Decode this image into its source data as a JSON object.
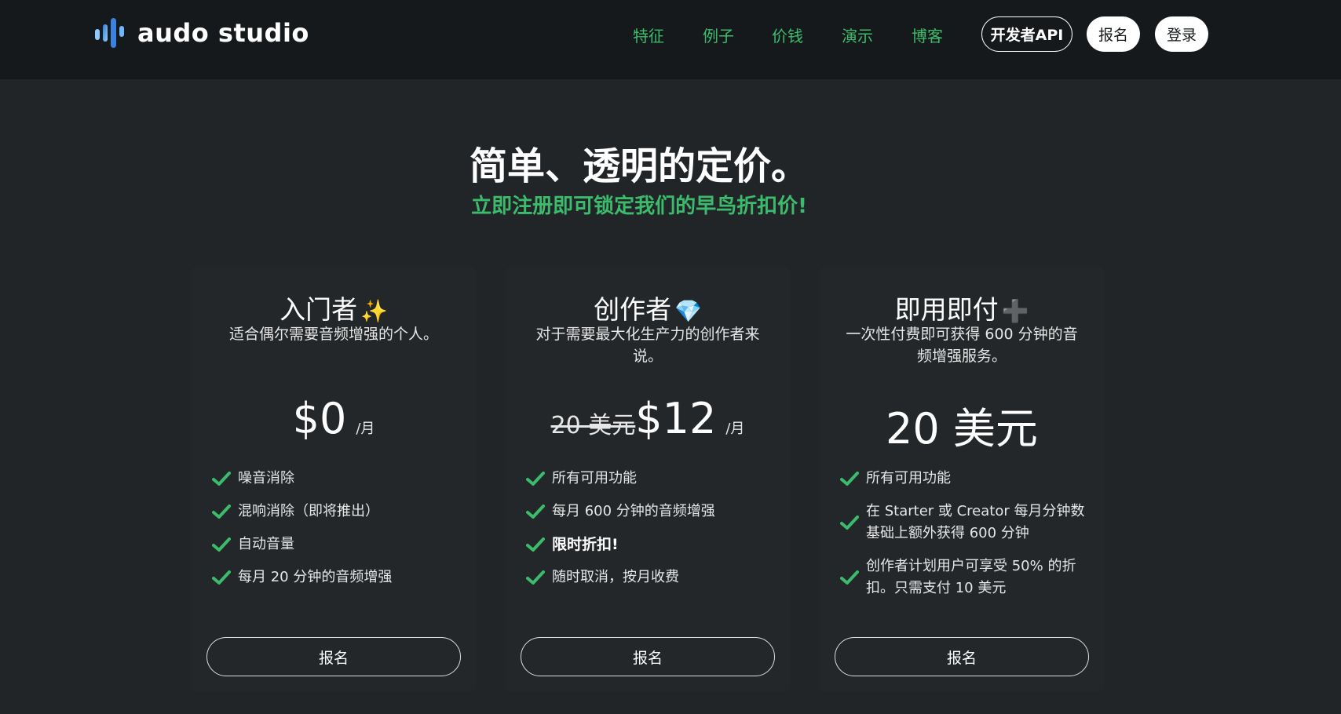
{
  "header": {
    "logo_text": "audo studio",
    "nav": [
      "特征",
      "例子",
      "价钱",
      "演示",
      "博客"
    ],
    "api_button": "开发者API",
    "signup_button": "报名",
    "login_button": "登录"
  },
  "hero": {
    "title": "简单、透明的定价。",
    "subtitle": "立即注册即可锁定我们的早鸟折扣价!"
  },
  "plans": [
    {
      "title": "入门者",
      "emoji": "✨",
      "description": "适合偶尔需要音频增强的个人。",
      "price_old": "",
      "price": "$0",
      "price_unit": "/月",
      "features": [
        "噪音消除",
        "混响消除（即将推出）",
        "自动音量",
        "每月 20 分钟的音频增强"
      ],
      "button": "报名"
    },
    {
      "title": "创作者",
      "emoji": "💎",
      "description": "对于需要最大化生产力的创作者来说。",
      "price_old": "20 美元",
      "price": "$12",
      "price_unit": "/月",
      "features": [
        "所有可用功能",
        "每月 600 分钟的音频增强",
        "限时折扣!",
        "随时取消，按月收费"
      ],
      "button": "报名"
    },
    {
      "title": "即用即付",
      "emoji": "➕",
      "description": "一次性付费即可获得 600 分钟的音频增强服务。",
      "price_old": "",
      "price": "20 美元",
      "price_unit": "",
      "features": [
        "所有可用功能",
        "在 Starter 或 Creator 每月分钟数基础上额外获得 600 分钟",
        "创作者计划用户可享受 50% 的折扣。只需支付 10 美元"
      ],
      "button": "报名"
    }
  ],
  "colors": {
    "accent_green": "#3dbb6c",
    "header_bg": "#16191b",
    "page_bg": "#222528",
    "card_bg": "#23272a"
  }
}
